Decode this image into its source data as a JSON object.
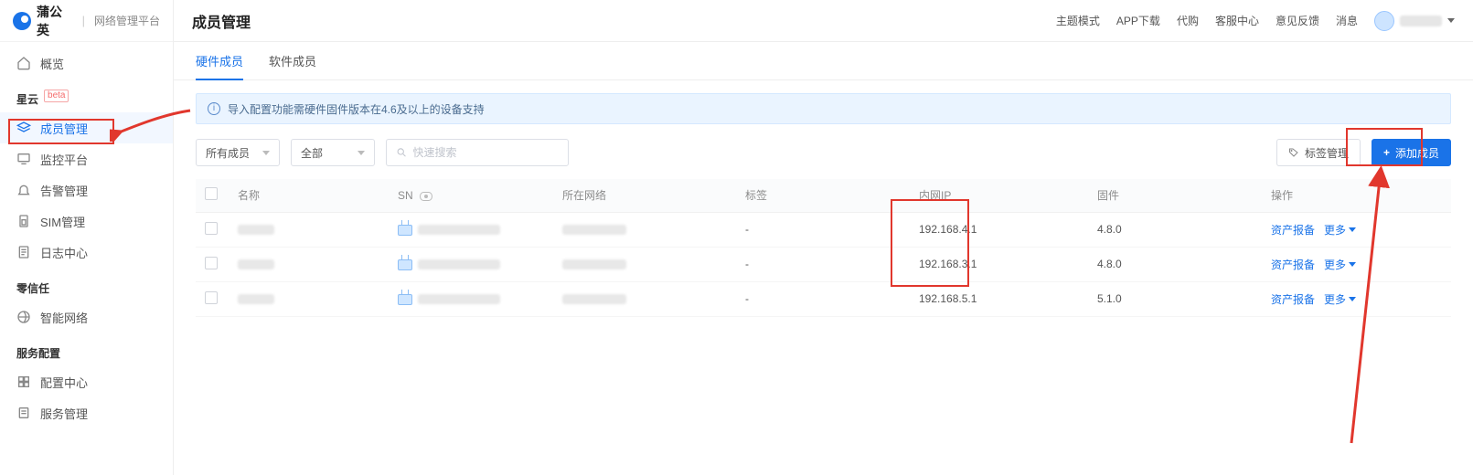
{
  "brand": {
    "name": "蒲公英",
    "subtitle": "网络管理平台"
  },
  "topbar": {
    "links": [
      "主题模式",
      "APP下载",
      "代购",
      "客服中心",
      "意见反馈",
      "消息"
    ]
  },
  "page_title": "成员管理",
  "tabs": [
    {
      "label": "硬件成员",
      "active": true
    },
    {
      "label": "软件成员",
      "active": false
    }
  ],
  "infobar": {
    "text": "导入配置功能需硬件固件版本在4.6及以上的设备支持"
  },
  "toolbar": {
    "select_scope": "所有成员",
    "select_filter": "全部",
    "search_placeholder": "快速搜索",
    "tag_manage_label": "标签管理",
    "add_member_label": "添加成员"
  },
  "sidebar": {
    "top_item": {
      "label": "概览"
    },
    "sections": [
      {
        "title": "星云",
        "beta": "beta",
        "items": [
          {
            "label": "成员管理",
            "active": true,
            "icon": "layers-icon"
          },
          {
            "label": "监控平台",
            "icon": "monitor-icon"
          },
          {
            "label": "告警管理",
            "icon": "bell-icon"
          },
          {
            "label": "SIM管理",
            "icon": "sim-icon"
          },
          {
            "label": "日志中心",
            "icon": "log-icon"
          }
        ]
      },
      {
        "title": "零信任",
        "items": [
          {
            "label": "智能网络",
            "icon": "network-icon"
          }
        ]
      },
      {
        "title": "服务配置",
        "items": [
          {
            "label": "配置中心",
            "icon": "config-icon"
          },
          {
            "label": "服务管理",
            "icon": "service-icon"
          }
        ]
      }
    ]
  },
  "table": {
    "columns": [
      "",
      "名称",
      "SN",
      "所在网络",
      "标签",
      "内网IP",
      "固件",
      "操作"
    ],
    "rows": [
      {
        "ip": "192.168.4.1",
        "fw": "4.8.0",
        "tag": "-",
        "asset_label": "资产报备",
        "more_label": "更多"
      },
      {
        "ip": "192.168.3.1",
        "fw": "4.8.0",
        "tag": "-",
        "asset_label": "资产报备",
        "more_label": "更多"
      },
      {
        "ip": "192.168.5.1",
        "fw": "5.1.0",
        "tag": "-",
        "asset_label": "资产报备",
        "more_label": "更多"
      }
    ]
  }
}
